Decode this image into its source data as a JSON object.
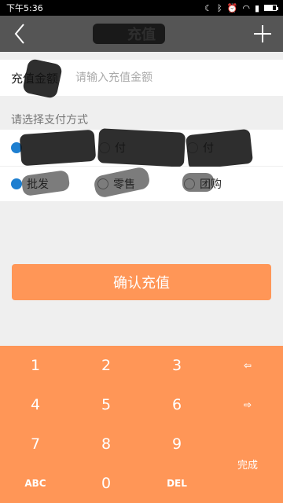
{
  "status_bar": {
    "time": "下午5:36",
    "battery_level": 0.7
  },
  "app_bar": {
    "title": "充值",
    "back_icon": "back-chevron-icon",
    "add_icon": "plus-icon"
  },
  "amount": {
    "label": "充值金额",
    "placeholder": "请输入充值金额",
    "value": ""
  },
  "payment": {
    "section_label": "请选择支付方式",
    "options": [
      {
        "label": "",
        "selected": true
      },
      {
        "label": "付",
        "selected": false
      },
      {
        "label": "付",
        "selected": false
      }
    ]
  },
  "sale_type": {
    "options": [
      {
        "label": "批发",
        "selected": true
      },
      {
        "label": "零售",
        "selected": false
      },
      {
        "label": "团购",
        "selected": false
      }
    ]
  },
  "confirm_button": {
    "label": "确认充值"
  },
  "keypad": {
    "keys": [
      "1",
      "2",
      "3",
      "⇦",
      "4",
      "5",
      "6",
      "⇨",
      "7",
      "8",
      "9",
      "ABC",
      "0",
      "DEL"
    ],
    "done_label": "完成"
  },
  "colors": {
    "accent": "#ff9657",
    "app_bar": "#555555",
    "radio_checked": "#1e7fd0"
  }
}
